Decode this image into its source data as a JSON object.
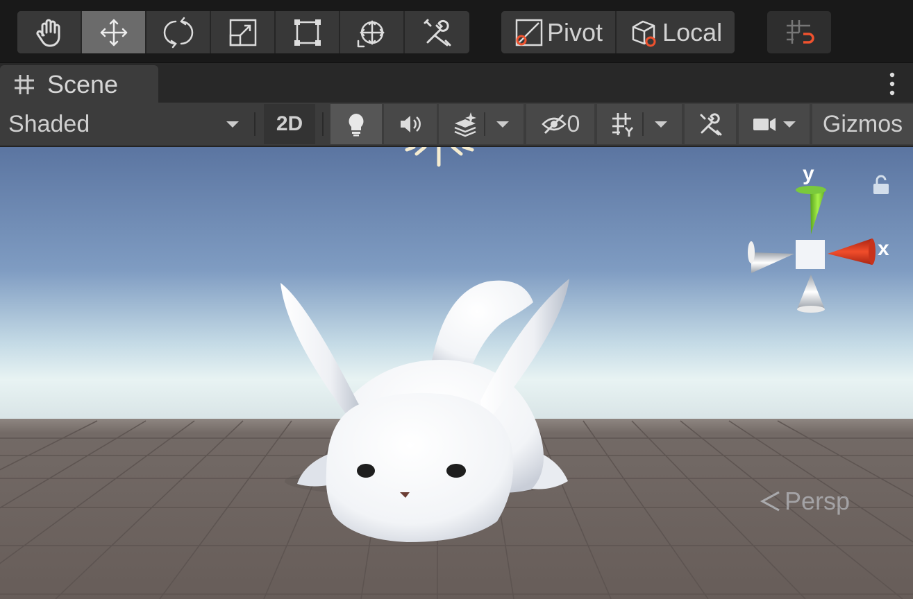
{
  "tools": {
    "items": [
      {
        "name": "hand-tool",
        "icon": "hand-icon",
        "active": false
      },
      {
        "name": "move-tool",
        "icon": "move-icon",
        "active": true
      },
      {
        "name": "rotate-tool",
        "icon": "rotate-icon",
        "active": false
      },
      {
        "name": "scale-tool",
        "icon": "scale-icon",
        "active": false
      },
      {
        "name": "rect-tool",
        "icon": "rect-transform-icon",
        "active": false
      },
      {
        "name": "transform-tool",
        "icon": "transform-icon",
        "active": false
      },
      {
        "name": "custom-tool",
        "icon": "wrench-screwdriver-icon",
        "active": false
      }
    ],
    "pivot_label": "Pivot",
    "local_label": "Local",
    "snap_icon": "grid-snap-icon"
  },
  "tab": {
    "title": "Scene",
    "icon": "scene-grid-icon",
    "menu_icon": "kebab-menu-icon"
  },
  "scene_toolbar": {
    "shading_mode": "Shaded",
    "mode_2d": "2D",
    "hidden_count": "0",
    "gizmos_label": "Gizmos"
  },
  "viewport": {
    "projection_label": "Persp",
    "axis_x": "x",
    "axis_y": "y",
    "colors": {
      "sky_top": "#5d78a3",
      "horizon": "#e6f2f3",
      "ground": "#6a605c",
      "axis_x": "#e0341e",
      "axis_y": "#7fd62d"
    }
  }
}
